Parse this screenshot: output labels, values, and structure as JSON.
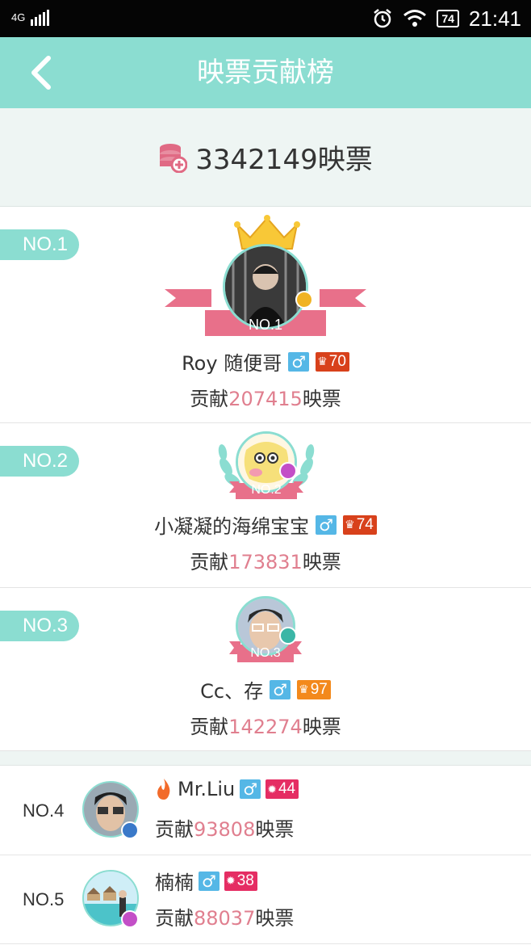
{
  "status_bar": {
    "network": "4G",
    "battery": "74",
    "time": "21:41"
  },
  "nav": {
    "title": "映票贡献榜",
    "back_icon": "chevron-left-icon"
  },
  "total": {
    "amount_text": "3342149映票",
    "icon": "coins-plus-icon"
  },
  "colors": {
    "accent": "#8bddd1",
    "number_pink": "#e07f8f",
    "gender_blue": "#55b7e6",
    "level_red": "#d8411b",
    "level_orange": "#f3891c",
    "level_pink": "#e52d63"
  },
  "top_entries": [
    {
      "rank_tab": "NO.1",
      "banner": "NO.1",
      "name": "Roy 随便哥",
      "gender": "♂",
      "level": "70",
      "contrib_prefix": "贡献",
      "contrib_value": "207415",
      "contrib_suffix": "映票"
    },
    {
      "rank_tab": "NO.2",
      "banner": "NO.2",
      "name": "小凝凝的海绵宝宝",
      "gender": "♂",
      "level": "74",
      "contrib_prefix": "贡献",
      "contrib_value": "173831",
      "contrib_suffix": "映票"
    },
    {
      "rank_tab": "NO.3",
      "banner": "NO.3",
      "name": "Cc、存",
      "gender": "♂",
      "level": "97",
      "contrib_prefix": "贡献",
      "contrib_value": "142274",
      "contrib_suffix": "映票"
    }
  ],
  "list_entries": [
    {
      "rank": "NO.4",
      "name": "Mr.Liu",
      "gender": "♂",
      "level": "44",
      "contrib_prefix": "贡献",
      "contrib_value": "93808",
      "contrib_suffix": "映票"
    },
    {
      "rank": "NO.5",
      "name": "楠楠",
      "gender": "♂",
      "level": "38",
      "contrib_prefix": "贡献",
      "contrib_value": "88037",
      "contrib_suffix": "映票"
    }
  ]
}
